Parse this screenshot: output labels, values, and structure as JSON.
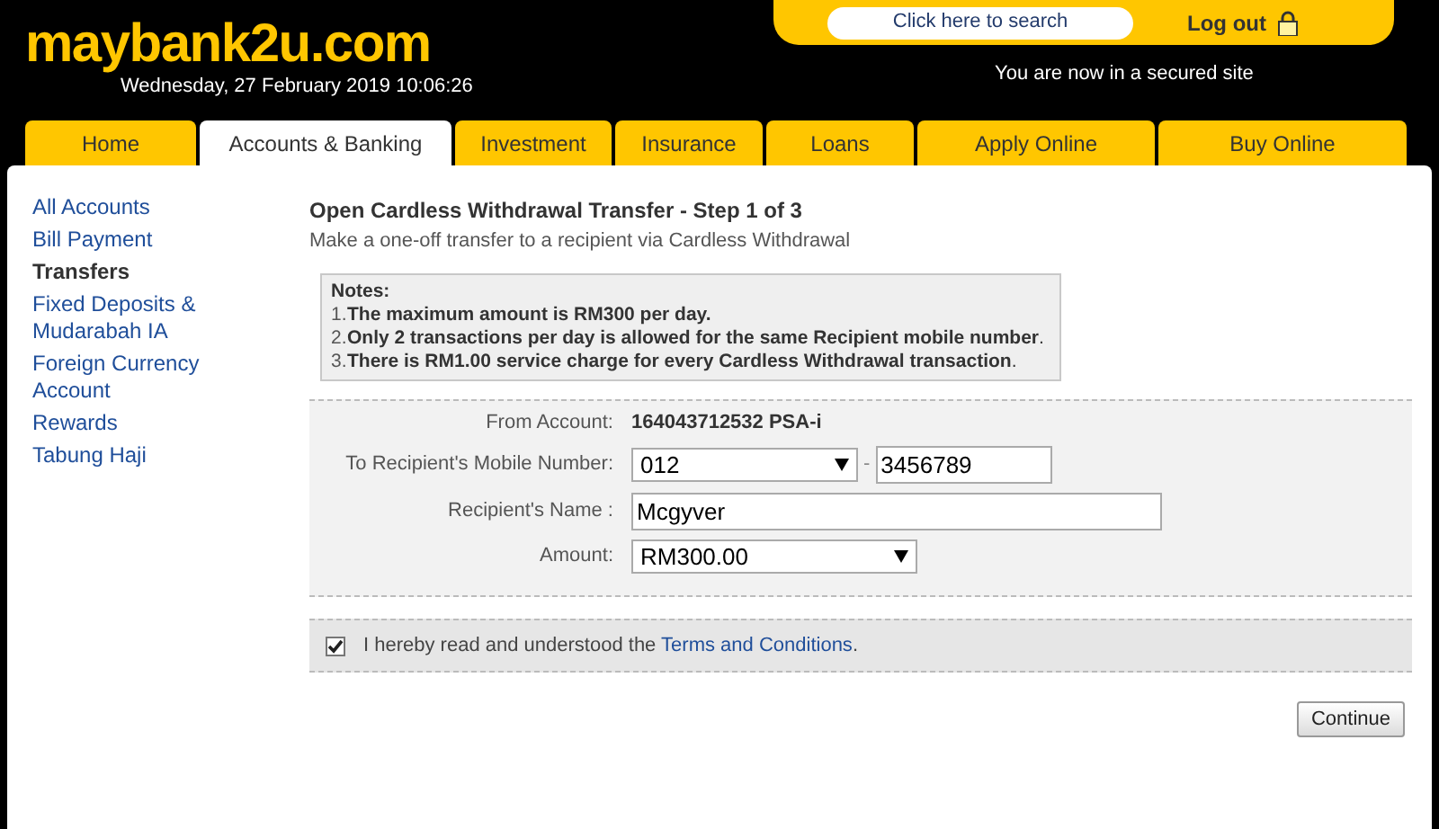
{
  "header": {
    "logo": "maybank2u.com",
    "datetime": "Wednesday, 27 February 2019 10:06:26",
    "search_placeholder": "Click here to search",
    "logout": "Log out",
    "secure_note": "You are now in a secured site"
  },
  "tabs": [
    {
      "label": "Home",
      "selected": false
    },
    {
      "label": "Accounts & Banking",
      "selected": true
    },
    {
      "label": "Investment",
      "selected": false
    },
    {
      "label": "Insurance",
      "selected": false
    },
    {
      "label": "Loans",
      "selected": false
    },
    {
      "label": "Apply Online",
      "selected": false
    },
    {
      "label": "Buy Online",
      "selected": false
    }
  ],
  "sidebar": {
    "items": [
      {
        "label": "All Accounts",
        "selected": false
      },
      {
        "label": "Bill Payment",
        "selected": false
      },
      {
        "label": "Transfers",
        "selected": true
      },
      {
        "label": "Fixed Deposits & Mudarabah IA",
        "selected": false
      },
      {
        "label": "Foreign Currency Account",
        "selected": false
      },
      {
        "label": "Rewards",
        "selected": false
      },
      {
        "label": "Tabung Haji",
        "selected": false
      }
    ]
  },
  "page": {
    "title": "Open Cardless Withdrawal Transfer - Step 1 of 3",
    "subtitle": "Make a one-off transfer to a recipient via Cardless Withdrawal"
  },
  "notes": {
    "title": "Notes:",
    "items": [
      {
        "number": "1.",
        "text": "**The maximum amount is RM300 per day.**"
      },
      {
        "number": "2.",
        "text": "**Only 2 transactions per day is allowed for the same Recipient mobile number**."
      },
      {
        "number": "3.",
        "text": "**There is RM1.00 service charge for every Cardless Withdrawal transaction**."
      }
    ]
  },
  "form": {
    "fields": [
      {
        "kind": "static",
        "label": "From Account:",
        "value": "164043712532 PSA-i"
      },
      {
        "kind": "phone",
        "label": "To Recipient's Mobile Number:",
        "prefix": "012",
        "separator": "-",
        "value": "3456789"
      },
      {
        "kind": "input",
        "label": "Recipient's Name :",
        "value": "Mcgyver"
      },
      {
        "kind": "select",
        "label": "Amount:",
        "value": "RM300.00"
      }
    ]
  },
  "agreement": {
    "checked": true,
    "text": "I hereby read and understood the ",
    "link": "Terms and Conditions",
    "suffix": "."
  },
  "buttons": [
    "Continue"
  ]
}
